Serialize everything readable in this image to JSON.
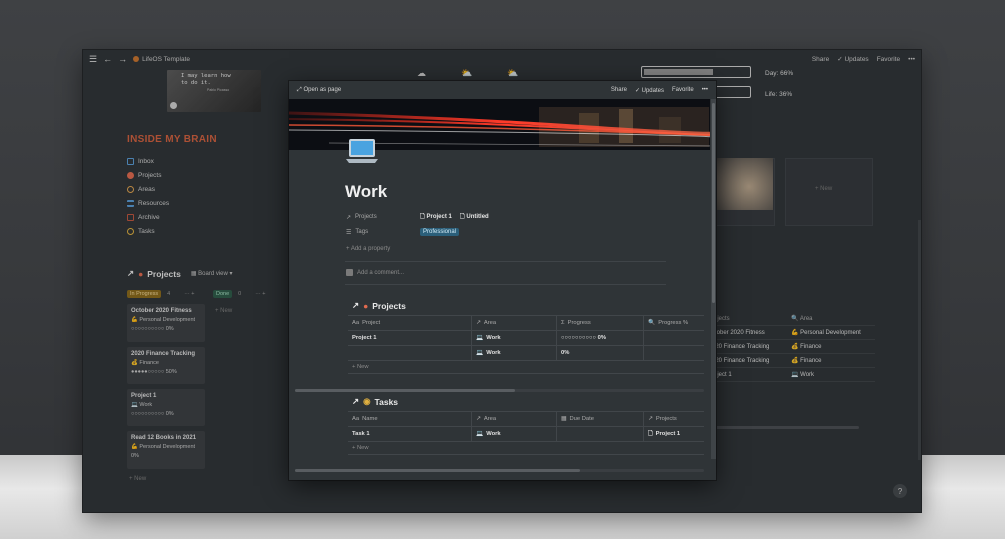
{
  "app": {
    "breadcrumb": "LifeOS Template",
    "share": "Share",
    "updates": "Updates",
    "favorite": "Favorite",
    "more": "•••"
  },
  "background": {
    "quote_line1": "I may learn how",
    "quote_line2": "to do it.",
    "quote_author": "Pablo Picasso",
    "brain_title": "INSIDE MY BRAIN",
    "brain_items": [
      "Inbox",
      "Projects",
      "Areas",
      "Resources",
      "Archive",
      "Tasks"
    ],
    "brain_colors": [
      "#5a9bd5",
      "#e06a4f",
      "#e0a34f",
      "#5a9bd5",
      "#c0563f",
      "#e0b040"
    ],
    "projects_title": "Projects",
    "board_view": "Board view",
    "in_progress": "In Progress",
    "in_progress_count": "4",
    "done": "Done",
    "done_count": "0",
    "add_new": "+ New",
    "cards": [
      {
        "title": "October 2020 Fitness",
        "area": "Personal Development",
        "progress": "○○○○○○○○○○ 0%"
      },
      {
        "title": "2020 Finance Tracking",
        "area": "Finance",
        "progress": "●●●●●○○○○○ 50%"
      },
      {
        "title": "Project 1",
        "area": "Work",
        "progress": "○○○○○○○○○○ 0%"
      },
      {
        "title": "Read 12 Books in 2021",
        "area": "Personal Development",
        "progress": "0%"
      }
    ],
    "day_label": "Day: 66%",
    "day_progress": 0.66,
    "life_label": "Life: 36%",
    "life_progress": 0.36,
    "gallery_new": "+ New",
    "table_headers": [
      "rojects",
      "Area"
    ],
    "table_rows": [
      [
        "ctober 2020 Fitness",
        "Personal Development"
      ],
      [
        "020 Finance Tracking",
        "Finance"
      ],
      [
        "020 Finance Tracking",
        "Finance"
      ],
      [
        "roject 1",
        "Work"
      ]
    ],
    "help": "?"
  },
  "modal": {
    "open_as_page": "Open as page",
    "share": "Share",
    "updates": "Updates",
    "favorite": "Favorite",
    "more": "•••",
    "title": "Work",
    "props": {
      "projects_key": "Projects",
      "projects_val1": "Project 1",
      "projects_val2": "Untitled",
      "tags_key": "Tags",
      "tags_val": "Professional"
    },
    "add_property": "+ Add a property",
    "add_comment": "Add a comment...",
    "projects_section": {
      "title": "Projects",
      "headers": [
        "Project",
        "Area",
        "Progress",
        "Progress %"
      ],
      "rows": [
        [
          "Project 1",
          "Work",
          "○○○○○○○○○○ 0%",
          ""
        ],
        [
          "",
          "Work",
          "0%",
          ""
        ]
      ],
      "new": "+ New"
    },
    "tasks_section": {
      "title": "Tasks",
      "headers": [
        "Name",
        "Area",
        "Due Date",
        "Projects"
      ],
      "rows": [
        [
          "Task 1",
          "Work",
          "",
          "Project 1"
        ]
      ],
      "new": "+ New"
    }
  }
}
